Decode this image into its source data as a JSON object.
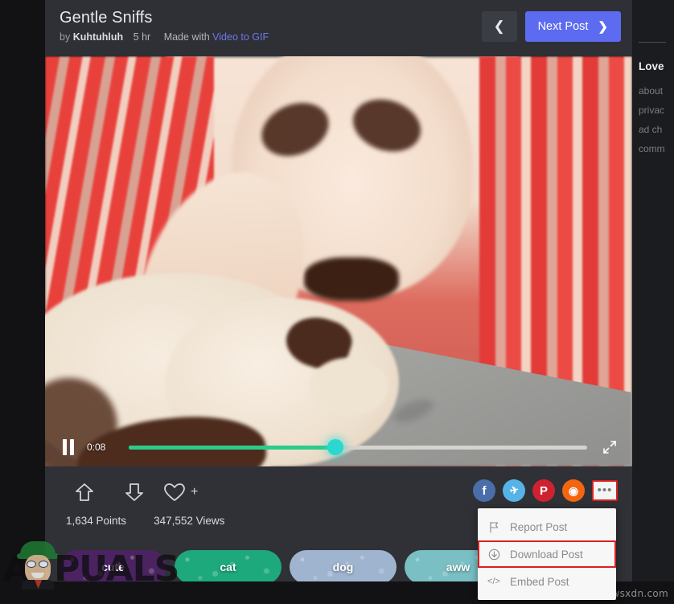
{
  "post": {
    "title": "Gentle Sniffs",
    "by_label": "by",
    "author": "Kuhtuhluh",
    "age": "5 hr",
    "made_with_label": "Made with",
    "made_with_tool": "Video to GIF"
  },
  "header": {
    "prev_icon": "chevron-left-icon",
    "next_label": "Next Post",
    "next_icon": "chevron-right-icon",
    "next_color": "#5c6bf0"
  },
  "player": {
    "state_icon": "pause-icon",
    "current_time": "0:08",
    "progress_percent": 45,
    "fullscreen_icon": "fullscreen-icon",
    "fill_color": "#2dcb8a",
    "thumb_color": "#2ad8cf"
  },
  "actions": {
    "upvote_icon": "arrow-up-icon",
    "downvote_icon": "arrow-down-icon",
    "favorite_icon": "heart-icon",
    "favorite_plus": "+",
    "points": "1,634 Points",
    "views": "347,552 Views"
  },
  "share": [
    {
      "name": "facebook",
      "glyph": "f",
      "color": "#4a6ea9"
    },
    {
      "name": "twitter",
      "glyph": "✈",
      "color": "#56b3e8"
    },
    {
      "name": "pinterest",
      "glyph": "P",
      "color": "#cf2231"
    },
    {
      "name": "reddit",
      "glyph": "◉",
      "color": "#f4650f"
    }
  ],
  "more_button": {
    "icon": "ellipsis-icon",
    "dots": "•••",
    "highlight_color": "#d92020"
  },
  "dropdown": {
    "items": [
      {
        "label": "Report Post",
        "icon": "flag-icon",
        "highlighted": false
      },
      {
        "label": "Download Post",
        "icon": "download-circle-icon",
        "highlighted": true
      },
      {
        "label": "Embed Post",
        "icon": "code-icon",
        "highlighted": false
      }
    ]
  },
  "tags": [
    {
      "label": "cute",
      "color": "#4a2360"
    },
    {
      "label": "cat",
      "color": "#1ea97c"
    },
    {
      "label": "dog",
      "color": "#9fb4cf"
    },
    {
      "label": "aww",
      "color": "#79bfc4"
    }
  ],
  "sidebar": {
    "title": "Love",
    "links": [
      "about",
      "privac",
      "ad ch",
      "comm"
    ]
  },
  "watermarks": {
    "brand": "PUALS",
    "brand_prefix": "A",
    "source": "wsxdn.com"
  }
}
